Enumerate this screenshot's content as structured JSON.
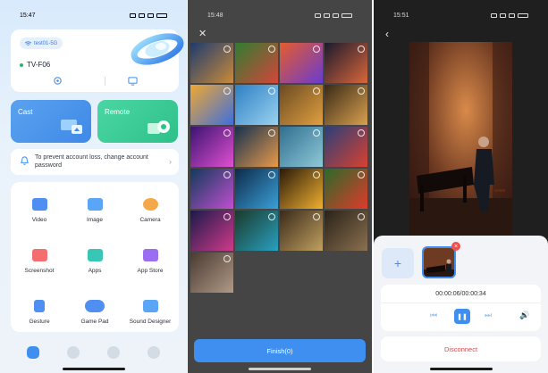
{
  "colors": {
    "accent": "#3e8ff0",
    "cast_tile": "#4a95ec",
    "remote_tile": "#38c996",
    "danger": "#e0474c",
    "online": "#2bb673"
  },
  "phone1": {
    "status_time": "15:47",
    "wifi_name": "test01-5G",
    "device_name": "TV-F06",
    "cast_label": "Cast",
    "remote_label": "Remote",
    "notice_text": "To prevent account loss, change account password",
    "features": [
      {
        "label": "Video",
        "icon": "video-icon"
      },
      {
        "label": "Image",
        "icon": "image-icon"
      },
      {
        "label": "Camera",
        "icon": "camera-icon"
      },
      {
        "label": "Screenshot",
        "icon": "screenshot-icon"
      },
      {
        "label": "Apps",
        "icon": "apps-icon"
      },
      {
        "label": "App Store",
        "icon": "app-store-icon"
      },
      {
        "label": "Gesture",
        "icon": "gesture-icon"
      },
      {
        "label": "Game Pad",
        "icon": "gamepad-icon"
      },
      {
        "label": "Sound Designer",
        "icon": "sound-designer-icon"
      }
    ],
    "tabs": [
      "home-tab-icon",
      "remote-tab-icon",
      "discover-tab-icon",
      "profile-tab-icon"
    ]
  },
  "phone2": {
    "status_time": "15:48",
    "finish_label": "Finish(0)",
    "photos": [
      "city-skyline-photo",
      "soccer-players-photo",
      "colorful-flower-photo",
      "sunset-sky-photo",
      "rainbow-light-photo",
      "dolphin-photo",
      "lion-portrait-photo",
      "leopard-photo",
      "neon-swirl-photo",
      "sunset-beach-photo",
      "mountain-lake-photo",
      "cathedral-photo",
      "coral-reef-photo",
      "ocean-wave-photo",
      "sun-horizon-photo",
      "parrot-photo",
      "abstract-waves-photo",
      "peacock-photo",
      "the-legend-begins-poster",
      "fantasy-army-poster",
      "running-man-photo"
    ]
  },
  "phone3": {
    "status_time": "15:51",
    "time_display": "00:00:06/00:00:34",
    "disconnect_label": "Disconnect"
  }
}
